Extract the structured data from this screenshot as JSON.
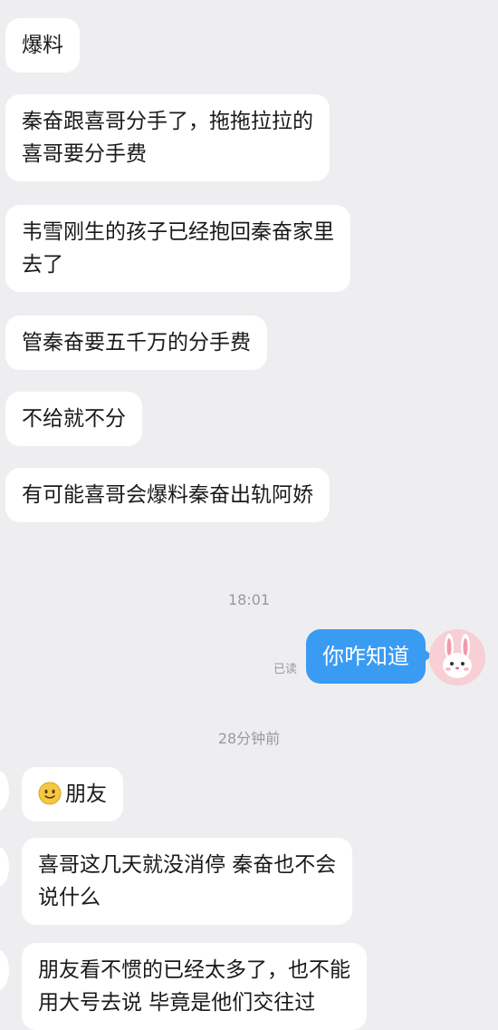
{
  "messages_top": [
    {
      "lines": [
        "爆料"
      ]
    },
    {
      "lines": [
        "秦奋跟喜哥分手了，拖拖拉拉的",
        "喜哥要分手费"
      ]
    },
    {
      "lines": [
        "韦雪刚生的孩子已经抱回秦奋家里",
        "去了"
      ]
    },
    {
      "lines": [
        "管秦奋要五千万的分手费"
      ]
    },
    {
      "lines": [
        "不给就不分"
      ]
    },
    {
      "lines": [
        "有可能喜哥会爆料秦奋出轨阿娇"
      ]
    }
  ],
  "timestamp_1": "18:01",
  "outgoing": {
    "text": "你咋知道",
    "read_status": "已读",
    "bubble_color": "#3a9bf3"
  },
  "timestamp_2": "28分钟前",
  "messages_bottom": [
    {
      "emoji": "slightly-smiling-face-icon",
      "lines": [
        "朋友"
      ]
    },
    {
      "lines": [
        "喜哥这几天就没消停 秦奋也不会",
        "说什么"
      ]
    },
    {
      "lines": [
        "朋友看不惯的已经太多了，也不能",
        "用大号去说 毕竟是他们交往过"
      ]
    }
  ],
  "colors": {
    "background": "#eeeef0",
    "incoming_bubble": "#ffffff",
    "outgoing_bubble": "#3a9bf3",
    "meta_text": "#9a9a9c"
  }
}
